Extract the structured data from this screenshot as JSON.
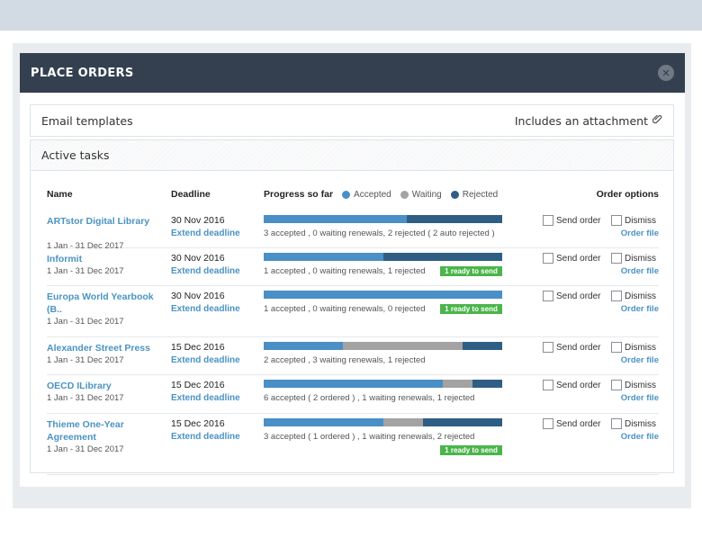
{
  "modal": {
    "title": "PLACE ORDERS",
    "close_icon": "close-icon"
  },
  "email": {
    "label": "Email templates",
    "attachment_label": "Includes an attachment",
    "attachment_icon": "paperclip-icon"
  },
  "tasks": {
    "label": "Active tasks",
    "headers": {
      "name": "Name",
      "deadline": "Deadline",
      "progress": "Progress so far",
      "accepted": "Accepted",
      "waiting": "Waiting",
      "rejected": "Rejected",
      "options": "Order options"
    },
    "colors": {
      "accepted": "#4a8fc6",
      "waiting": "#a3a3a3",
      "rejected": "#2f5e85",
      "ready": "#4bb54b"
    },
    "send_label": "Send order",
    "dismiss_label": "Dismiss",
    "order_file_label": "Order file",
    "extend_label": "Extend deadline",
    "ready_label": "1 ready to send",
    "rows": [
      {
        "name": "ARTstor Digital Library",
        "dates": "1 Jan - 31 Dec 2017",
        "deadline": "30 Nov 2016",
        "accepted": 3,
        "waiting": 0,
        "rejected": 2,
        "summary": "3 accepted , 0 waiting renewals, 2 rejected ( 2 auto rejected )",
        "ready": false
      },
      {
        "name": "Informit",
        "dates": "1 Jan - 31 Dec 2017",
        "deadline": "30 Nov 2016",
        "accepted": 1,
        "waiting": 0,
        "rejected": 1,
        "summary": "1 accepted , 0 waiting renewals, 1 rejected",
        "ready": true
      },
      {
        "name": "Europa World Yearbook (B..",
        "dates": "1 Jan - 31 Dec 2017",
        "deadline": "30 Nov 2016",
        "accepted": 1,
        "waiting": 0,
        "rejected": 0,
        "summary": "1 accepted , 0 waiting renewals, 0 rejected",
        "ready": true
      },
      {
        "name": "Alexander Street Press",
        "dates": "1 Jan - 31 Dec 2017",
        "deadline": "15 Dec 2016",
        "accepted": 2,
        "waiting": 3,
        "rejected": 1,
        "summary": "2 accepted , 3 waiting renewals, 1 rejected",
        "ready": false
      },
      {
        "name": "OECD ILibrary",
        "dates": "1 Jan - 31 Dec 2017",
        "deadline": "15 Dec 2016",
        "accepted": 6,
        "waiting": 1,
        "rejected": 1,
        "summary": "6 accepted ( 2 ordered ) , 1 waiting renewals, 1 rejected",
        "ready": false
      },
      {
        "name": "Thieme One-Year Agreement",
        "dates": "1 Jan - 31 Dec 2017",
        "deadline": "15 Dec 2016",
        "accepted": 3,
        "waiting": 1,
        "rejected": 2,
        "summary": "3 accepted ( 1 ordered ) , 1 waiting renewals, 2 rejected",
        "ready": true
      }
    ]
  }
}
